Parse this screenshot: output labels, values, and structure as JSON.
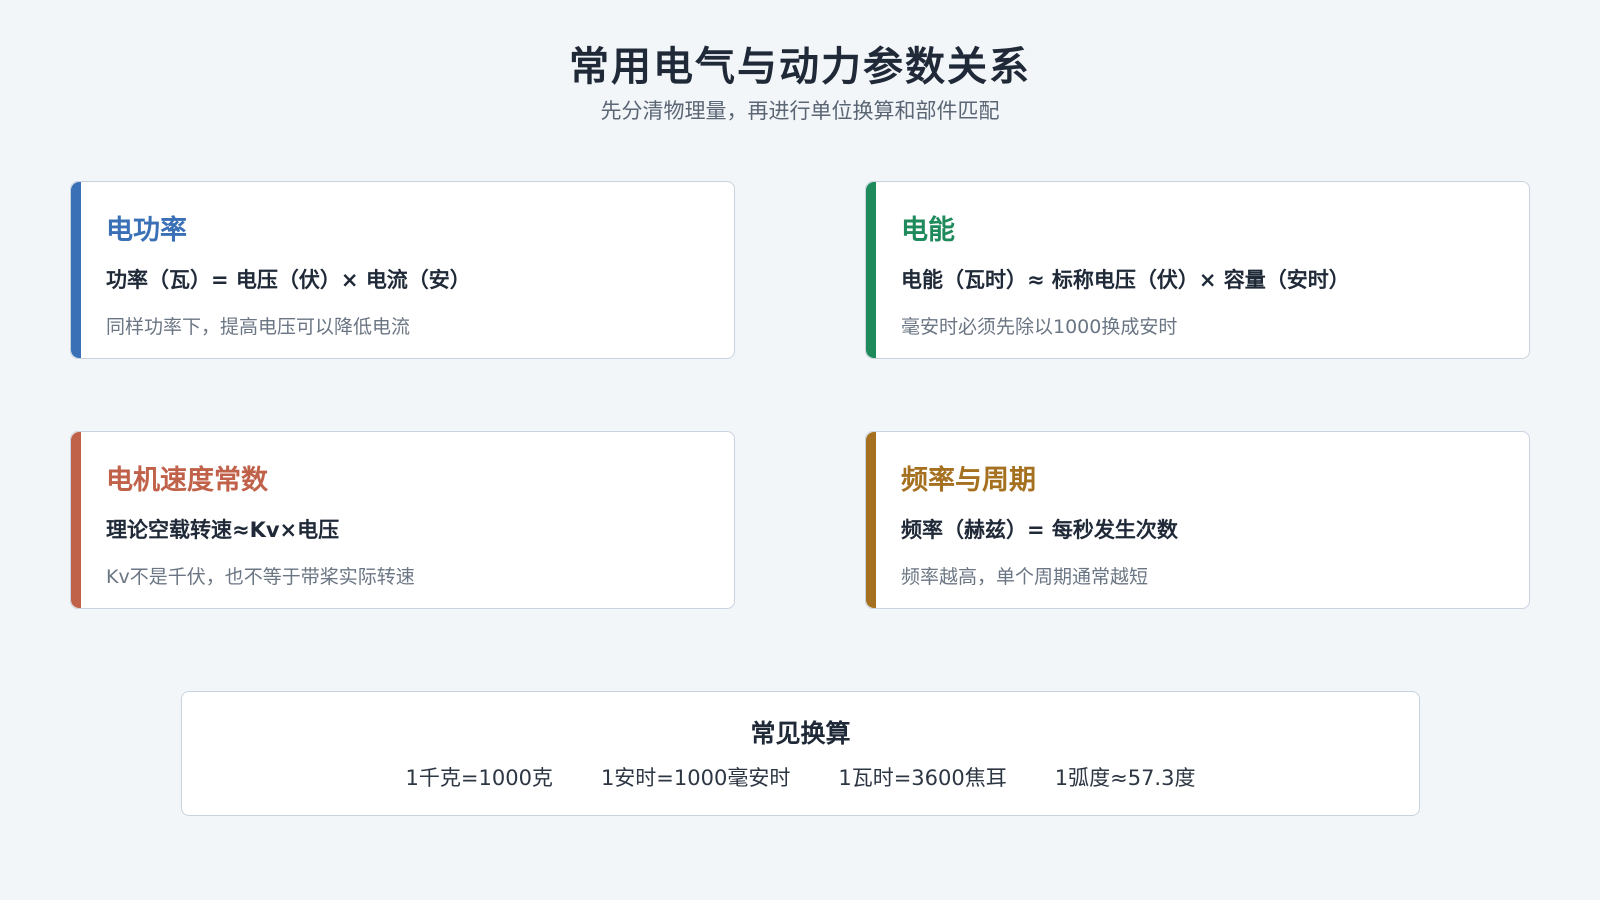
{
  "header": {
    "title": "常用电气与动力参数关系",
    "subtitle": "先分清物理量，再进行单位换算和部件匹配"
  },
  "cards": [
    {
      "title": "电功率",
      "formula": "功率（瓦）= 电压（伏）× 电流（安）",
      "note": "同样功率下，提高电压可以降低电流",
      "color": "#3a70b5"
    },
    {
      "title": "电能",
      "formula": "电能（瓦时）≈ 标称电压（伏）× 容量（安时）",
      "note": "毫安时必须先除以1000换成安时",
      "color": "#1f8a5b"
    },
    {
      "title": "电机速度常数",
      "formula": "理论空载转速≈Kv×电压",
      "note": "Kv不是千伏，也不等于带桨实际转速",
      "color": "#c0614a"
    },
    {
      "title": "频率与周期",
      "formula": "频率（赫兹）= 每秒发生次数",
      "note": "频率越高，单个周期通常越短",
      "color": "#a5701f"
    }
  ],
  "conversions": {
    "title": "常见换算",
    "items": [
      "1千克=1000克",
      "1安时=1000毫安时",
      "1瓦时=3600焦耳",
      "1弧度≈57.3度"
    ]
  }
}
